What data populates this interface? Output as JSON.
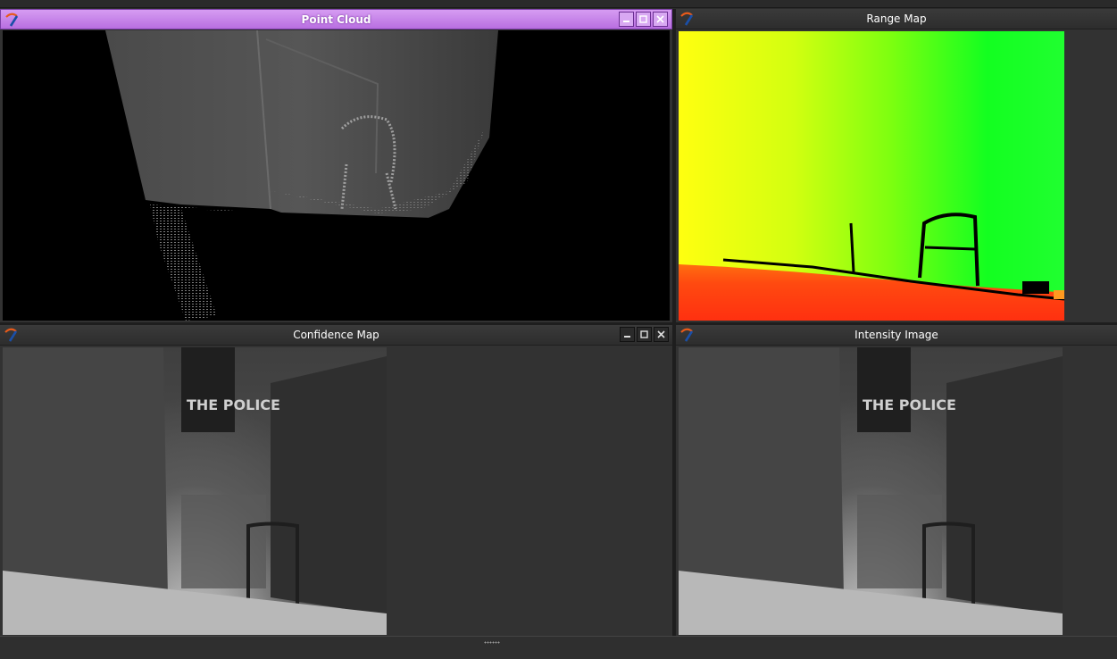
{
  "windows": {
    "point_cloud": {
      "title": "Point Cloud"
    },
    "range_map": {
      "title": "Range Map"
    },
    "confidence_map": {
      "title": "Confidence Map"
    },
    "intensity_image": {
      "title": "Intensity Image"
    }
  },
  "controls": {
    "minimize": "minimize-icon",
    "maximize": "maximize-icon",
    "close": "close-icon"
  },
  "colors": {
    "active_titlebar": "#c07ee6",
    "inactive_titlebar": "#333333",
    "range_near": "#ff3010",
    "range_mid": "#ffff10",
    "range_far": "#13ff20"
  },
  "poster": {
    "text": "THE POLICE"
  }
}
